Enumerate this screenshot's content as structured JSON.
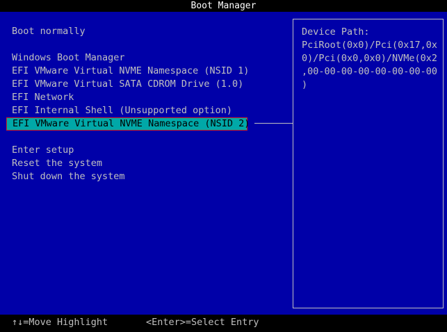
{
  "title": "Boot Manager",
  "menu": {
    "boot_normally": "Boot normally",
    "items": [
      "Windows Boot Manager",
      "EFI VMware Virtual NVME Namespace (NSID 1)",
      "EFI VMware Virtual SATA CDROM Drive (1.0)",
      "EFI Network",
      "EFI Internal Shell (Unsupported option)",
      "EFI VMware Virtual NVME Namespace (NSID 2)"
    ],
    "selected_index": 5,
    "actions": [
      "Enter setup",
      "Reset the system",
      "Shut down the system"
    ]
  },
  "info_panel": {
    "label": "Device Path:",
    "lines": [
      "PciRoot(0x0)/Pci(0x17,0x",
      "0)/Pci(0x0,0x0)/NVMe(0x2",
      ",00-00-00-00-00-00-00-00",
      ")"
    ]
  },
  "footer": {
    "move_hint": "↑↓=Move Highlight",
    "select_hint": "<Enter>=Select Entry"
  },
  "colors": {
    "background": "#0000a8",
    "text": "#c0c0c0",
    "highlight_bg": "#00a8a8",
    "highlight_border": "#cc2222",
    "bar_bg": "#000000"
  }
}
